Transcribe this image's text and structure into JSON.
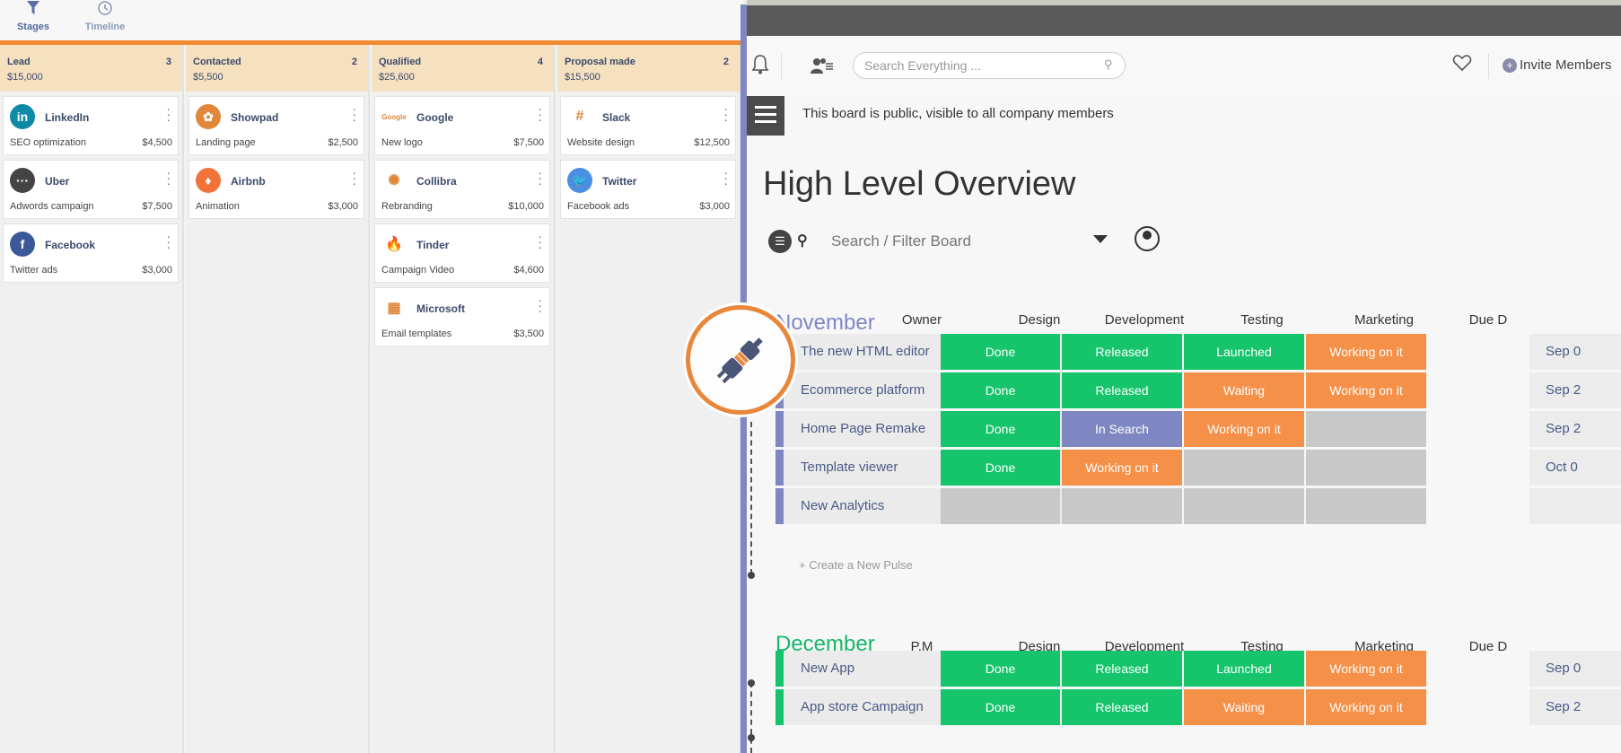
{
  "left_tabs": [
    {
      "label": "Stages",
      "active": true
    },
    {
      "label": "Timeline",
      "active": false
    }
  ],
  "stages": [
    {
      "name": "Lead",
      "amount": "$15,000",
      "count": "3",
      "cards": [
        {
          "company": "LinkedIn",
          "desc": "SEO optimization",
          "amount": "$4,500",
          "logo": "linkedin-logo",
          "color": "#0e8aa8",
          "glyph": "in"
        },
        {
          "company": "Uber",
          "desc": "Adwords campaign",
          "amount": "$7,500",
          "logo": "uber-logo",
          "color": "#444444",
          "glyph": "···"
        },
        {
          "company": "Facebook",
          "desc": "Twitter ads",
          "amount": "$3,000",
          "logo": "facebook-logo",
          "color": "#3b5998",
          "glyph": "f"
        }
      ]
    },
    {
      "name": "Contacted",
      "amount": "$5,500",
      "count": "2",
      "cards": [
        {
          "company": "Showpad",
          "desc": "Landing page",
          "amount": "$2,500",
          "logo": "showpad-logo",
          "color": "#e0873a",
          "glyph": "✿"
        },
        {
          "company": "Airbnb",
          "desc": "Animation",
          "amount": "$3,000",
          "logo": "airbnb-logo",
          "color": "#f2733a",
          "glyph": "♦"
        }
      ]
    },
    {
      "name": "Qualified",
      "amount": "$25,600",
      "count": "4",
      "cards": [
        {
          "company": "Google",
          "desc": "New logo",
          "amount": "$7,500",
          "logo": "google-logo",
          "color": "#ffffff",
          "glyph": "Google"
        },
        {
          "company": "Collibra",
          "desc": "Rebranding",
          "amount": "$10,000",
          "logo": "collibra-logo",
          "color": "#ffffff",
          "glyph": "✺"
        },
        {
          "company": "Tinder",
          "desc": "Campaign Video",
          "amount": "$4,600",
          "logo": "tinder-logo",
          "color": "#ffffff",
          "glyph": "🔥"
        },
        {
          "company": "Microsoft",
          "desc": "Email templates",
          "amount": "$3,500",
          "logo": "microsoft-logo",
          "color": "#ffffff",
          "glyph": "▦"
        }
      ]
    },
    {
      "name": "Proposal made",
      "amount": "$15,500",
      "count": "2",
      "cards": [
        {
          "company": "Slack",
          "desc": "Website design",
          "amount": "$12,500",
          "logo": "slack-logo",
          "color": "#ffffff",
          "glyph": "#"
        },
        {
          "company": "Twitter",
          "desc": "Facebook ads",
          "amount": "$3,000",
          "logo": "twitter-logo",
          "color": "#4a90e2",
          "glyph": "🐦"
        }
      ]
    }
  ],
  "board": {
    "search_placeholder": "Search Everything ...",
    "invite_label": "Invite Members",
    "public_notice": "This board is public, visible to all company members",
    "title": "High Level Overview",
    "filter_placeholder": "Search / Filter Board",
    "create_pulse": "+ Create a New Pulse",
    "groups": [
      {
        "title": "November",
        "title_color": "#7f87c2",
        "owner_header": "Owner",
        "stripe": "#7f87c2",
        "columns": [
          "Design",
          "Development",
          "Testing",
          "Marketing",
          "Due D"
        ],
        "rows": [
          {
            "name": "The new HTML editor",
            "avatar": true,
            "cells": [
              [
                "Done",
                "#16c46c"
              ],
              [
                "Released",
                "#16c46c"
              ],
              [
                "Launched",
                "#16c46c"
              ],
              [
                "Working on it",
                "#f49048"
              ]
            ],
            "due": "Sep 0"
          },
          {
            "name": "Ecommerce platform",
            "avatar": true,
            "cells": [
              [
                "Done",
                "#16c46c"
              ],
              [
                "Released",
                "#16c46c"
              ],
              [
                "Waiting",
                "#f49048"
              ],
              [
                "Working on it",
                "#f49048"
              ]
            ],
            "due": "Sep 2"
          },
          {
            "name": "Home Page Remake",
            "avatar": true,
            "cells": [
              [
                "Done",
                "#16c46c"
              ],
              [
                "In Search",
                "#7f87c2"
              ],
              [
                "Working on it",
                "#f49048"
              ],
              [
                "",
                "#c8c8c8"
              ]
            ],
            "due": "Sep 2"
          },
          {
            "name": "Template viewer",
            "avatar": true,
            "cells": [
              [
                "Done",
                "#16c46c"
              ],
              [
                "Working on it",
                "#f49048"
              ],
              [
                "",
                "#c8c8c8"
              ],
              [
                "",
                "#c8c8c8"
              ]
            ],
            "due": "Oct 0"
          },
          {
            "name": "New Analytics",
            "avatar": false,
            "cells": [
              [
                "",
                "#c8c8c8"
              ],
              [
                "",
                "#c8c8c8"
              ],
              [
                "",
                "#c8c8c8"
              ],
              [
                "",
                "#c8c8c8"
              ]
            ],
            "due": ""
          }
        ]
      },
      {
        "title": "December",
        "title_color": "#16b86a",
        "owner_header": "P.M",
        "stripe": "#16c46c",
        "columns": [
          "Design",
          "Development",
          "Testing",
          "Marketing",
          "Due D"
        ],
        "rows": [
          {
            "name": "New App",
            "avatar": true,
            "cells": [
              [
                "Done",
                "#16c46c"
              ],
              [
                "Released",
                "#16c46c"
              ],
              [
                "Launched",
                "#16c46c"
              ],
              [
                "Working on it",
                "#f49048"
              ]
            ],
            "due": "Sep 0"
          },
          {
            "name": "App store Campaign",
            "avatar": true,
            "cells": [
              [
                "Done",
                "#16c46c"
              ],
              [
                "Released",
                "#16c46c"
              ],
              [
                "Waiting",
                "#f49048"
              ],
              [
                "Working on it",
                "#f49048"
              ]
            ],
            "due": "Sep 2"
          }
        ]
      }
    ]
  },
  "badge_icon": "plug-icon"
}
